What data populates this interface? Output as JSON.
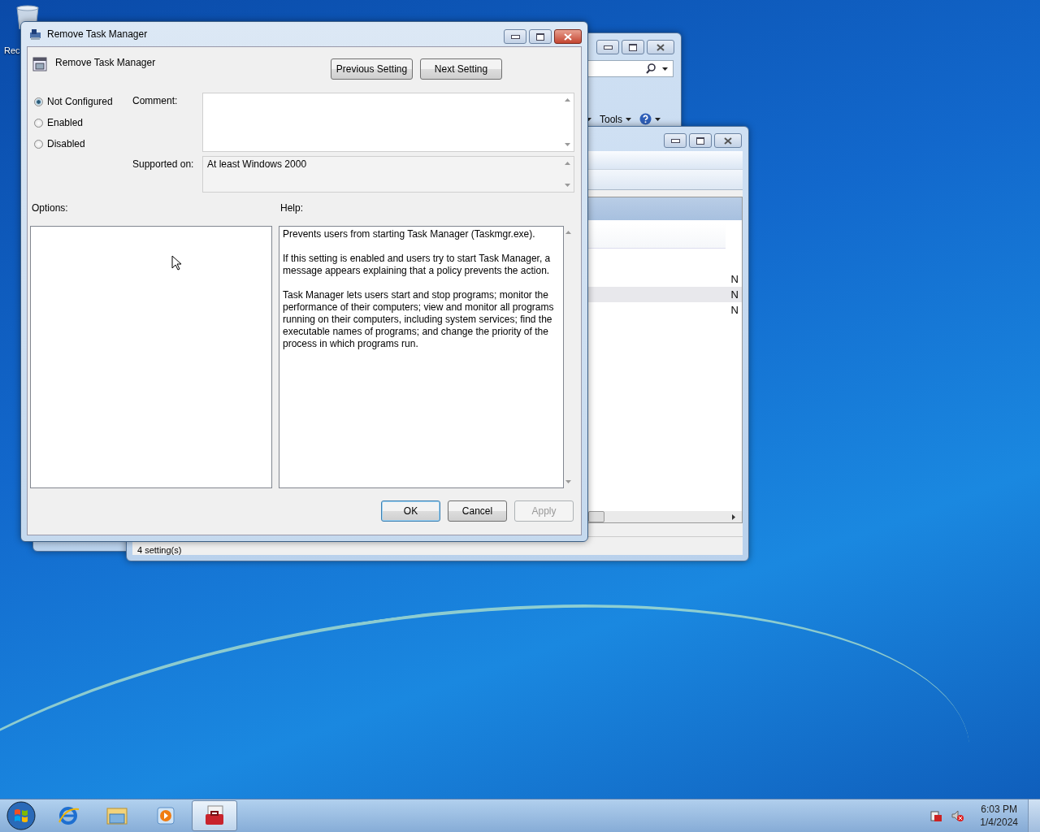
{
  "desktop": {
    "icons": [
      {
        "label": "Rec"
      }
    ]
  },
  "background_windows": [
    {
      "kind": "explorer",
      "toolbar": [
        {
          "label": "Tools"
        }
      ]
    },
    {
      "kind": "list",
      "rows": [
        {
          "cell": "N",
          "selected": false
        },
        {
          "cell": "N",
          "selected": true
        },
        {
          "cell": "N",
          "selected": false
        }
      ],
      "status_bar": "4 setting(s)"
    }
  ],
  "dialog": {
    "title": "Remove Task Manager",
    "setting_name": "Remove Task Manager",
    "nav_buttons": [
      {
        "label": "Previous Setting"
      },
      {
        "label": "Next Setting"
      }
    ],
    "states": [
      {
        "label": "Not Configured",
        "selected": true
      },
      {
        "label": "Enabled",
        "selected": false
      },
      {
        "label": "Disabled",
        "selected": false
      }
    ],
    "comment_label": "Comment:",
    "supported_label": "Supported on:",
    "supported_value": "At least Windows 2000",
    "options_label": "Options:",
    "help_label": "Help:",
    "help_text": [
      "Prevents users from starting Task Manager (Taskmgr.exe).",
      "If this setting is enabled and users try to start Task Manager, a message appears explaining that a policy prevents the action.",
      "Task Manager lets users start and stop programs; monitor the performance of their computers; view and monitor all programs running on their computers, including system services; find the executable names of programs; and change the priority of the process in which programs run."
    ],
    "buttons": [
      {
        "label": "OK",
        "default": true,
        "disabled": false
      },
      {
        "label": "Cancel",
        "default": false,
        "disabled": false
      },
      {
        "label": "Apply",
        "default": false,
        "disabled": true
      }
    ]
  },
  "taskbar": {
    "items": [
      {
        "kind": "browser",
        "active": false
      },
      {
        "kind": "folder",
        "active": false
      },
      {
        "kind": "media",
        "active": false
      },
      {
        "kind": "toolbox",
        "active": true
      }
    ],
    "clock": {
      "time": "6:03 PM",
      "date": "1/4/2024"
    }
  }
}
